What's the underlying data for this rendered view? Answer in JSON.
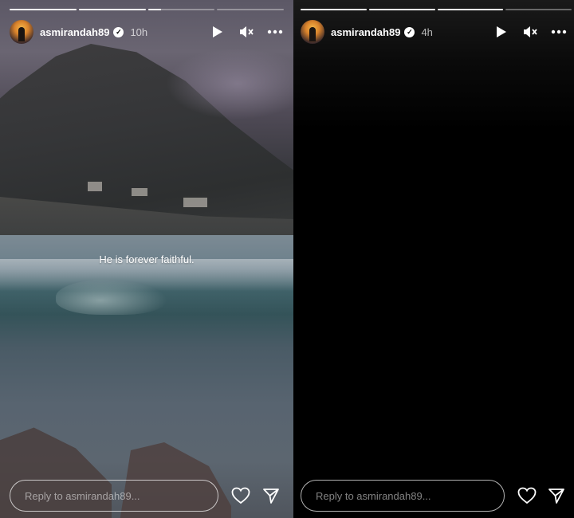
{
  "stories": [
    {
      "username": "asmirandah89",
      "verified_glyph": "✓",
      "time": "10h",
      "caption": "He is forever faithful.",
      "reply_placeholder": "Reply to asmirandah89...",
      "progress_fill": [
        1,
        1,
        0.2,
        0
      ],
      "icons": [
        "play-icon",
        "mute-icon",
        "more-icon",
        "heart-icon",
        "send-icon"
      ]
    },
    {
      "username": "asmirandah89",
      "verified_glyph": "✓",
      "time": "4h",
      "reply_placeholder": "Reply to asmirandah89...",
      "progress_fill": [
        1,
        1,
        1,
        0
      ],
      "icons": [
        "play-icon",
        "mute-icon",
        "more-icon",
        "heart-icon",
        "send-icon"
      ]
    }
  ],
  "colors": {
    "background": "#000000",
    "text": "#ffffff"
  }
}
